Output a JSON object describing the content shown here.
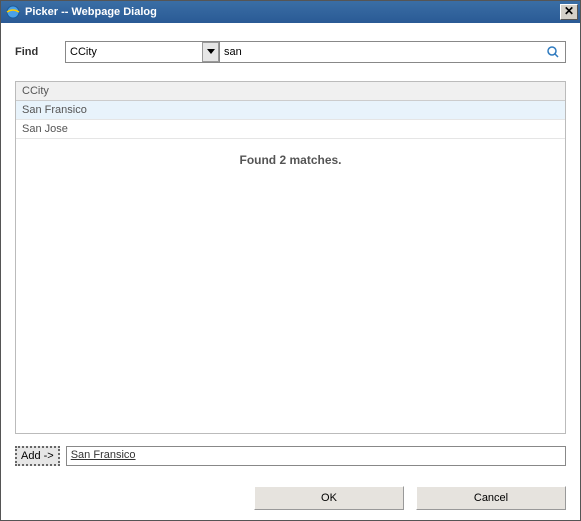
{
  "window": {
    "title": "Picker -- Webpage Dialog"
  },
  "find": {
    "label": "Find",
    "field_selected": "CCity",
    "search_value": "san"
  },
  "results": {
    "header": "CCity",
    "rows": [
      "San Fransico",
      "San Jose"
    ],
    "selected_index": 0,
    "status": "Found 2 matches."
  },
  "add": {
    "button_label": "Add ->",
    "selected_value": "San Fransico"
  },
  "buttons": {
    "ok": "OK",
    "cancel": "Cancel"
  }
}
